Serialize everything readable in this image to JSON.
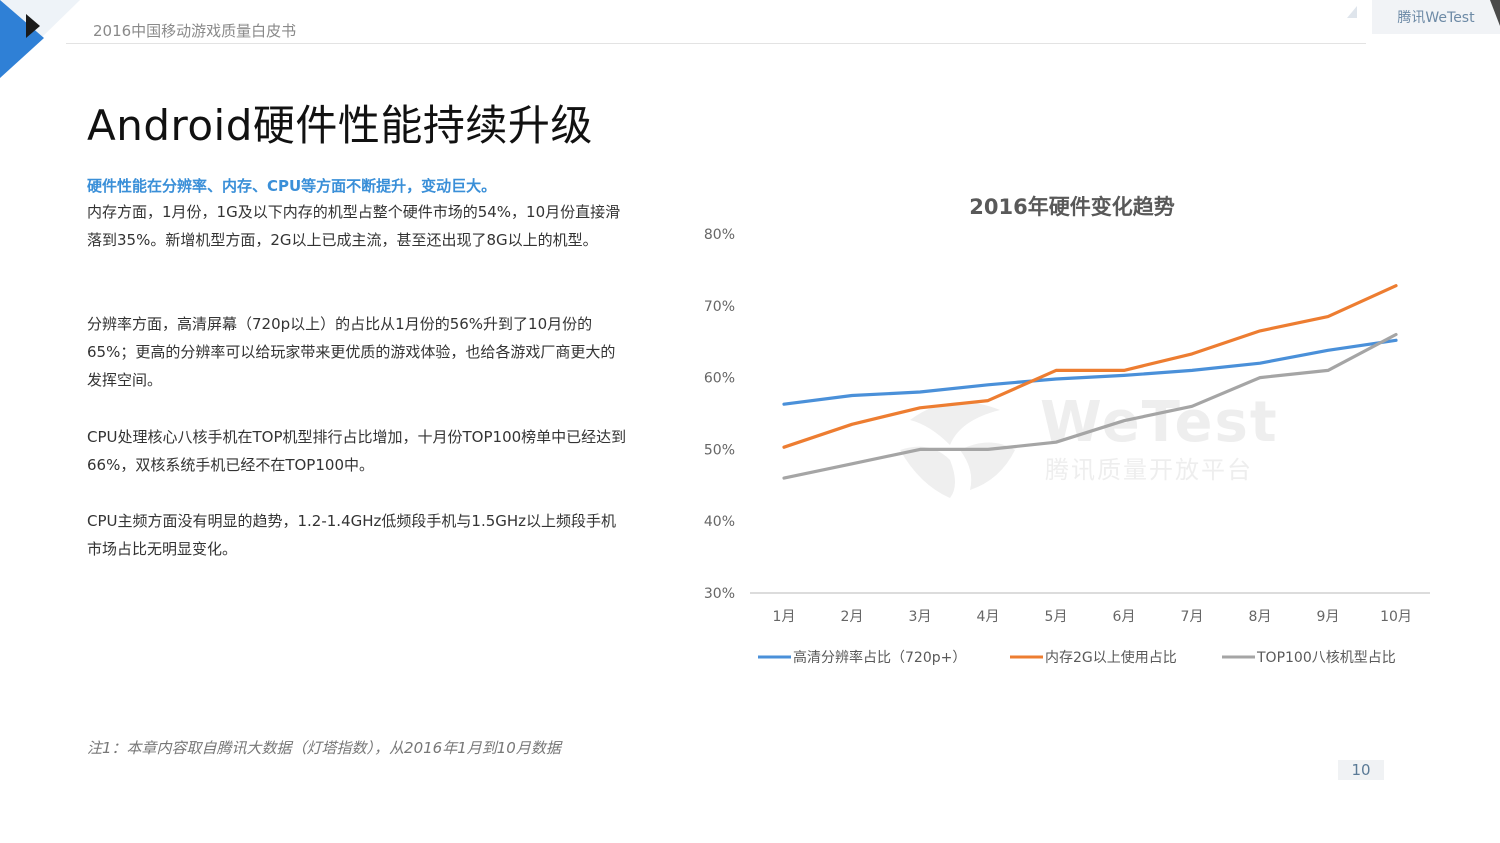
{
  "header": {
    "report_title": "2016中国移动游戏质量白皮书",
    "brand": "腾讯WeTest"
  },
  "page": {
    "title": "Android硬件性能持续升级",
    "highlight": "硬件性能在分辨率、内存、CPU等方面不断提升，变动巨大。",
    "paragraphs": [
      "内存方面，1月份，1G及以下内存的机型占整个硬件市场的54%，10月份直接滑落到35%。新增机型方面，2G以上已成主流，甚至还出现了8G以上的机型。",
      "分辨率方面，高清屏幕（720p以上）的占比从1月份的56%升到了10月份的65%；更高的分辨率可以给玩家带来更优质的游戏体验，也给各游戏厂商更大的发挥空间。",
      "CPU处理核心八核手机在TOP机型排行占比增加，十月份TOP100榜单中已经达到66%，双核系统手机已经不在TOP100中。",
      "CPU主频方面没有明显的趋势，1.2-1.4GHz低频段手机与1.5GHz以上频段手机市场占比无明显变化。"
    ],
    "footnote": "注1：本章内容取自腾讯大数据（灯塔指数），从2016年1月到10月数据",
    "page_number": "10"
  },
  "watermark": {
    "text": "WeTest",
    "subtext": "腾讯质量开放平台"
  },
  "chart_data": {
    "type": "line",
    "title": "2016年硬件变化趋势",
    "categories": [
      "1月",
      "2月",
      "3月",
      "4月",
      "5月",
      "6月",
      "7月",
      "8月",
      "9月",
      "10月"
    ],
    "y_ticks": [
      "30%",
      "40%",
      "50%",
      "60%",
      "70%",
      "80%"
    ],
    "ylim": [
      30,
      80
    ],
    "grid": false,
    "legend_position": "bottom",
    "series": [
      {
        "name": "高清分辨率占比（720p+）",
        "color": "#4a90d9",
        "values": [
          56.3,
          57.5,
          58,
          59,
          59.8,
          60.3,
          61,
          62,
          63.8,
          65.2
        ]
      },
      {
        "name": "内存2G以上使用占比",
        "color": "#ed7d31",
        "values": [
          50.3,
          53.5,
          55.8,
          56.8,
          61,
          61,
          63.3,
          66.5,
          68.5,
          72.8
        ]
      },
      {
        "name": "TOP100八核机型占比",
        "color": "#a5a5a5",
        "values": [
          46,
          48,
          50,
          50,
          51,
          54,
          56,
          60,
          61,
          66
        ]
      }
    ]
  }
}
